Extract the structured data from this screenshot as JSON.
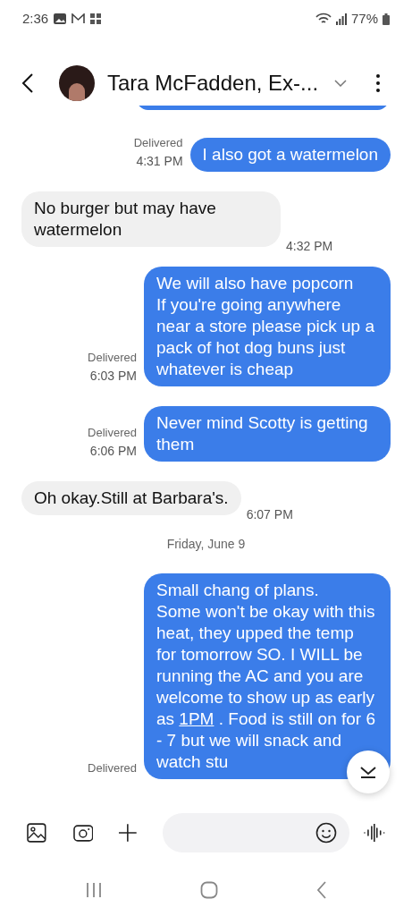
{
  "status_bar": {
    "time": "2:36",
    "battery": "77%"
  },
  "header": {
    "title": "Tara McFadden, Ex-..."
  },
  "messages": [
    {
      "kind": "sent",
      "text": "I also got a watermelon",
      "status": "Delivered",
      "time": "4:31 PM"
    },
    {
      "kind": "received",
      "text": "No burger but may have watermelon",
      "time": "4:32 PM"
    },
    {
      "kind": "sent",
      "text": "We will also have popcorn\nIf you're going anywhere near a store please pick up a pack of hot dog buns just whatever is cheap",
      "status": "Delivered",
      "time": "6:03 PM"
    },
    {
      "kind": "sent",
      "text": "Never mind Scotty is getting them",
      "status": "Delivered",
      "time": "6:06 PM"
    },
    {
      "kind": "received",
      "text": "Oh okay.Still at Barbara's.",
      "time": "6:07 PM"
    },
    {
      "kind": "date",
      "text": "Friday, June 9"
    },
    {
      "kind": "sent",
      "text": "Small chang of plans.\nSome won't be okay with this heat, they upped the temp for tomorrow SO. I WILL be running the AC and you are welcome to show up as early as ",
      "link": "1PM",
      "text_after": " .  Food is still on for 6 - 7 but we will snack and watch stu",
      "status": "Delivered"
    }
  ]
}
